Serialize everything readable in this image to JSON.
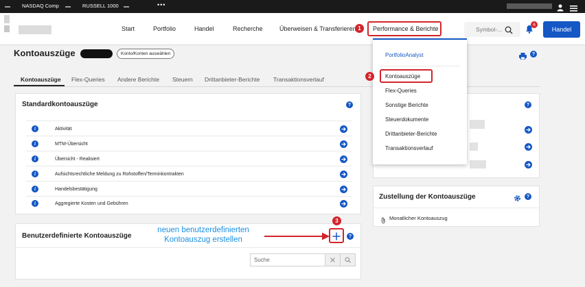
{
  "ticker": {
    "items": [
      "NASDAQ Comp",
      "RUSSELL 1000"
    ],
    "more": "•••"
  },
  "nav": {
    "items": [
      "Start",
      "Portfolio",
      "Handel",
      "Recherche",
      "Überweisen & Transferieren",
      "Performance & Berichte"
    ],
    "search_placeholder": "Symbol-...",
    "trade_button": "Handel",
    "notification_count": "6"
  },
  "page": {
    "title": "Kontoauszüge",
    "account_select": "Konto/Konten auswählen"
  },
  "tabs": [
    "Kontoauszüge",
    "Flex-Queries",
    "Andere Berichte",
    "Steuern",
    "Drittanbieter-Berichte",
    "Transaktionsverlauf"
  ],
  "standard": {
    "title": "Standardkontoauszüge",
    "rows": [
      "Aktivität",
      "MTM-Übersicht",
      "Übersicht - Realisiert",
      "Aufsichtsrechtliche Meldung zu Rohstoffen/Terminkontrakten",
      "Handelsbestätigung",
      "Aggregierte Kosten und Gebühren"
    ]
  },
  "custom": {
    "title": "Benutzerdefinierte Kontoauszüge",
    "search_placeholder": "Suche"
  },
  "menu": {
    "header": "PortfolioAnalyst",
    "items": [
      "Kontoauszüge",
      "Flex-Queries",
      "Sonstige Berichte",
      "Steuerdokumente",
      "Drittanbieter-Berichte",
      "Transaktionsverlauf"
    ]
  },
  "delivery": {
    "title": "Zustellung der Kontoauszüge",
    "item": "Monatlicher Kontoauszug"
  },
  "annotations": {
    "steps": [
      "1",
      "2",
      "3"
    ],
    "text_line1": "neuen benutzerdefinierten",
    "text_line2": "Kontoauszug erstellen"
  },
  "colors": {
    "brand_blue": "#1457c5",
    "annotation_red": "#d3242a",
    "annotation_text": "#1a8fe0"
  }
}
